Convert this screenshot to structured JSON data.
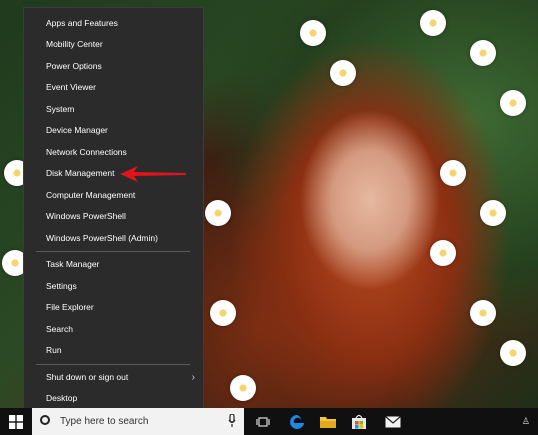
{
  "menu": {
    "items": [
      {
        "label": "Apps and Features"
      },
      {
        "label": "Mobility Center"
      },
      {
        "label": "Power Options"
      },
      {
        "label": "Event Viewer"
      },
      {
        "label": "System"
      },
      {
        "label": "Device Manager"
      },
      {
        "label": "Network Connections"
      },
      {
        "label": "Disk Management"
      },
      {
        "label": "Computer Management"
      },
      {
        "label": "Windows PowerShell"
      },
      {
        "label": "Windows PowerShell (Admin)"
      },
      {
        "label": "Task Manager"
      },
      {
        "label": "Settings"
      },
      {
        "label": "File Explorer"
      },
      {
        "label": "Search"
      },
      {
        "label": "Run"
      },
      {
        "label": "Shut down or sign out"
      },
      {
        "label": "Desktop"
      }
    ]
  },
  "taskbar": {
    "search_placeholder": "Type here to search",
    "icons": [
      "windows-logo-icon",
      "microphone-icon",
      "task-view-icon",
      "edge-icon",
      "file-explorer-icon",
      "store-icon",
      "mail-icon"
    ]
  },
  "annotation": {
    "color": "#e0141a"
  }
}
